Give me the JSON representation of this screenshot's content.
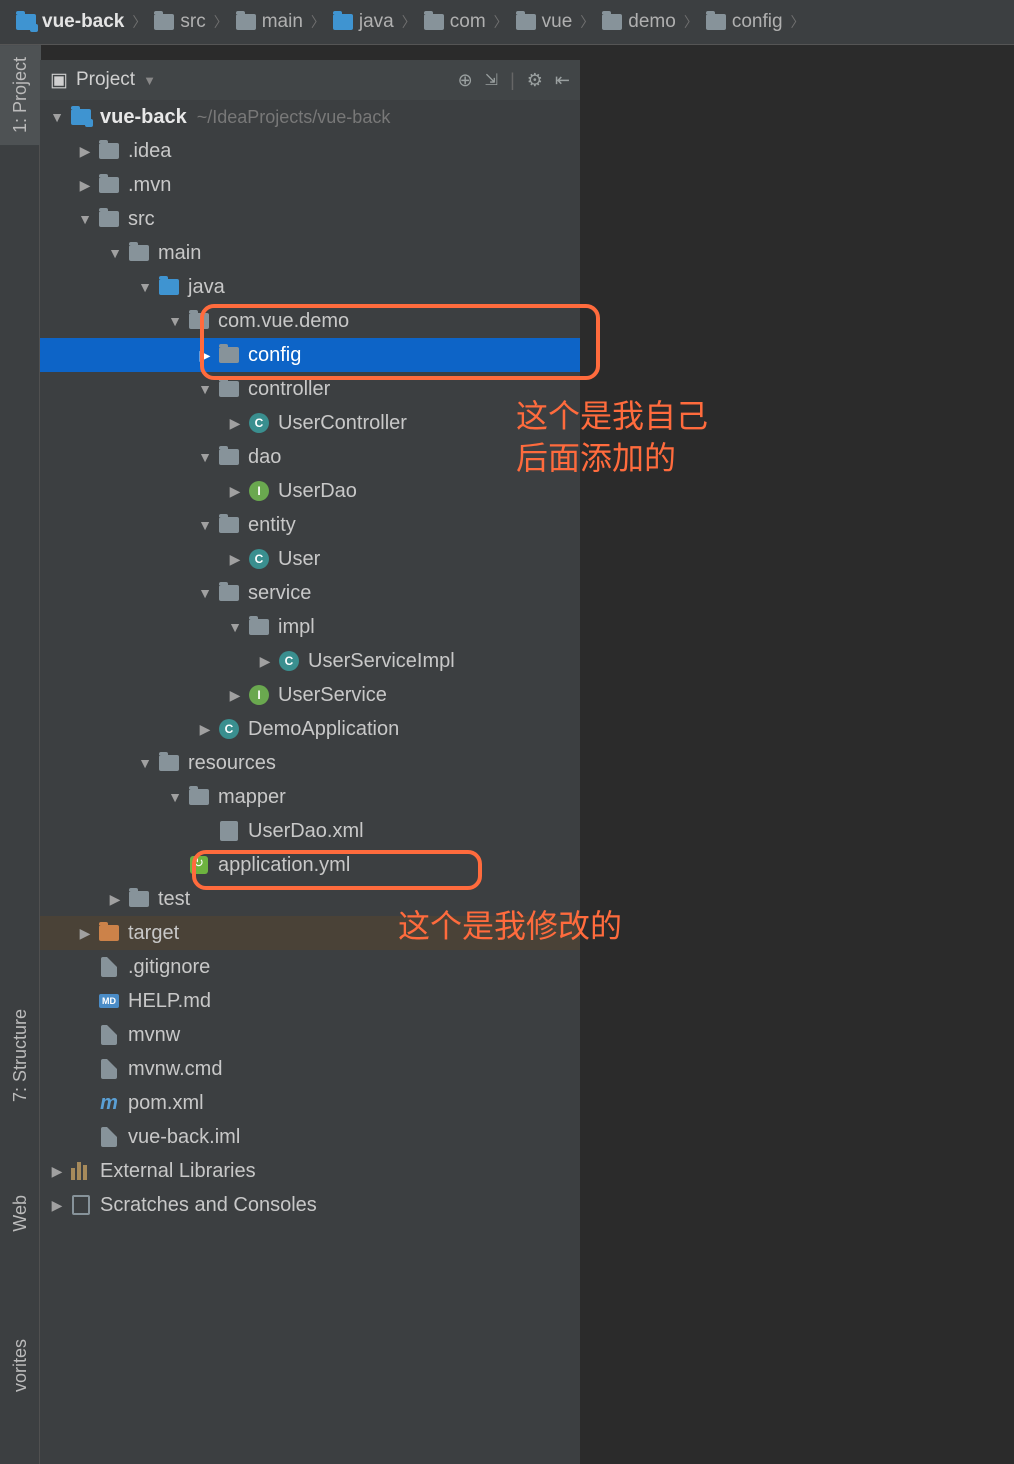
{
  "breadcrumb": [
    "vue-back",
    "src",
    "main",
    "java",
    "com",
    "vue",
    "demo",
    "config"
  ],
  "projectHeader": {
    "label": "Project"
  },
  "sidebarTabs": {
    "project": "1: Project",
    "structure": "7: Structure",
    "web": "Web",
    "favorites": "vorites"
  },
  "tree": {
    "root": {
      "name": "vue-back",
      "path": "~/IdeaProjects/vue-back"
    },
    "idea": ".idea",
    "mvn": ".mvn",
    "src": "src",
    "main": "main",
    "java": "java",
    "pkg": "com.vue.demo",
    "config": "config",
    "controller": "controller",
    "userController": "UserController",
    "dao": "dao",
    "userDao": "UserDao",
    "entity": "entity",
    "user": "User",
    "service": "service",
    "impl": "impl",
    "userServiceImpl": "UserServiceImpl",
    "userService": "UserService",
    "demoApplication": "DemoApplication",
    "resources": "resources",
    "mapper": "mapper",
    "userDaoXml": "UserDao.xml",
    "applicationYml": "application.yml",
    "test": "test",
    "target": "target",
    "gitignore": ".gitignore",
    "helpMd": "HELP.md",
    "mvnw": "mvnw",
    "mvnwCmd": "mvnw.cmd",
    "pomXml": "pom.xml",
    "iml": "vue-back.iml",
    "extLib": "External Libraries",
    "scratches": "Scratches and Consoles"
  },
  "annotations": {
    "added": "这个是我自己\n后面添加的",
    "modified": "这个是我修改的"
  }
}
